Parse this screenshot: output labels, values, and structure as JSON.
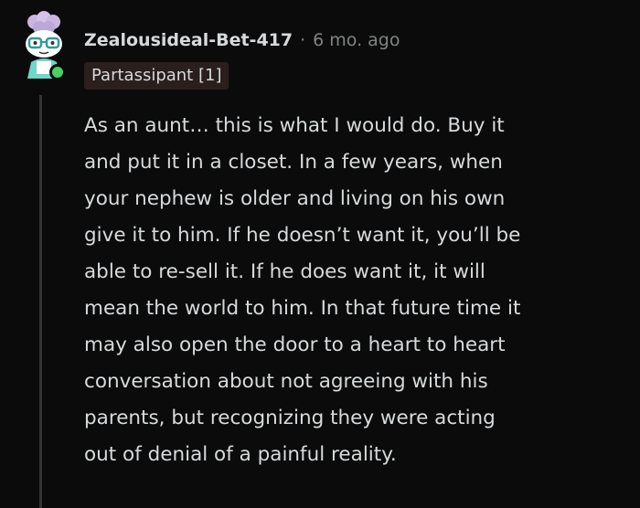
{
  "comment": {
    "author": "Zealousideal-Bet-417",
    "separator": "·",
    "timestamp": "6 mo. ago",
    "flair": "Partassipant [1]",
    "online_status_color": "#46d160",
    "body_lines": [
      "As an aunt… this is what I would do. Buy it",
      "and put it in a closet. In a few years, when",
      "your nephew is older and living on his own",
      "give it to him. If he doesn’t want it, you’ll be",
      "able to re-sell it. If he does want it, it will",
      "mean the world to him. In that future time it",
      "may also open the door to a heart to heart",
      "conversation about not agreeing with his",
      "parents, but recognizing they were acting",
      "out of denial of a painful reality."
    ]
  },
  "colors": {
    "background": "#0b0b0b",
    "text": "#d7dadc",
    "meta": "#818384",
    "flair_bg": "#2a1f1c",
    "thread_line": "#343536"
  },
  "icons": {
    "avatar": "snoo-avatar-icon"
  }
}
